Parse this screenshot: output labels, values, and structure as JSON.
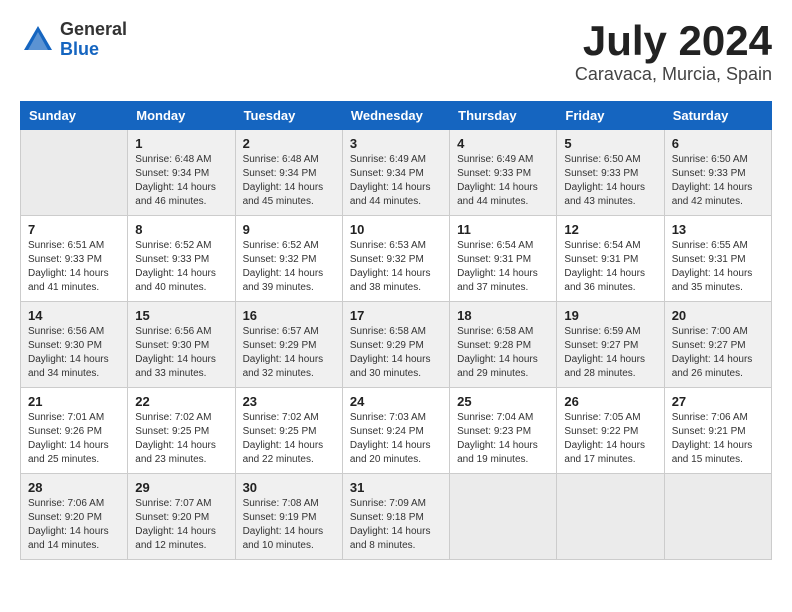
{
  "header": {
    "logo_general": "General",
    "logo_blue": "Blue",
    "month": "July 2024",
    "location": "Caravaca, Murcia, Spain"
  },
  "days_of_week": [
    "Sunday",
    "Monday",
    "Tuesday",
    "Wednesday",
    "Thursday",
    "Friday",
    "Saturday"
  ],
  "weeks": [
    [
      {
        "day": "",
        "info": ""
      },
      {
        "day": "1",
        "info": "Sunrise: 6:48 AM\nSunset: 9:34 PM\nDaylight: 14 hours\nand 46 minutes."
      },
      {
        "day": "2",
        "info": "Sunrise: 6:48 AM\nSunset: 9:34 PM\nDaylight: 14 hours\nand 45 minutes."
      },
      {
        "day": "3",
        "info": "Sunrise: 6:49 AM\nSunset: 9:34 PM\nDaylight: 14 hours\nand 44 minutes."
      },
      {
        "day": "4",
        "info": "Sunrise: 6:49 AM\nSunset: 9:33 PM\nDaylight: 14 hours\nand 44 minutes."
      },
      {
        "day": "5",
        "info": "Sunrise: 6:50 AM\nSunset: 9:33 PM\nDaylight: 14 hours\nand 43 minutes."
      },
      {
        "day": "6",
        "info": "Sunrise: 6:50 AM\nSunset: 9:33 PM\nDaylight: 14 hours\nand 42 minutes."
      }
    ],
    [
      {
        "day": "7",
        "info": "Sunrise: 6:51 AM\nSunset: 9:33 PM\nDaylight: 14 hours\nand 41 minutes."
      },
      {
        "day": "8",
        "info": "Sunrise: 6:52 AM\nSunset: 9:33 PM\nDaylight: 14 hours\nand 40 minutes."
      },
      {
        "day": "9",
        "info": "Sunrise: 6:52 AM\nSunset: 9:32 PM\nDaylight: 14 hours\nand 39 minutes."
      },
      {
        "day": "10",
        "info": "Sunrise: 6:53 AM\nSunset: 9:32 PM\nDaylight: 14 hours\nand 38 minutes."
      },
      {
        "day": "11",
        "info": "Sunrise: 6:54 AM\nSunset: 9:31 PM\nDaylight: 14 hours\nand 37 minutes."
      },
      {
        "day": "12",
        "info": "Sunrise: 6:54 AM\nSunset: 9:31 PM\nDaylight: 14 hours\nand 36 minutes."
      },
      {
        "day": "13",
        "info": "Sunrise: 6:55 AM\nSunset: 9:31 PM\nDaylight: 14 hours\nand 35 minutes."
      }
    ],
    [
      {
        "day": "14",
        "info": "Sunrise: 6:56 AM\nSunset: 9:30 PM\nDaylight: 14 hours\nand 34 minutes."
      },
      {
        "day": "15",
        "info": "Sunrise: 6:56 AM\nSunset: 9:30 PM\nDaylight: 14 hours\nand 33 minutes."
      },
      {
        "day": "16",
        "info": "Sunrise: 6:57 AM\nSunset: 9:29 PM\nDaylight: 14 hours\nand 32 minutes."
      },
      {
        "day": "17",
        "info": "Sunrise: 6:58 AM\nSunset: 9:29 PM\nDaylight: 14 hours\nand 30 minutes."
      },
      {
        "day": "18",
        "info": "Sunrise: 6:58 AM\nSunset: 9:28 PM\nDaylight: 14 hours\nand 29 minutes."
      },
      {
        "day": "19",
        "info": "Sunrise: 6:59 AM\nSunset: 9:27 PM\nDaylight: 14 hours\nand 28 minutes."
      },
      {
        "day": "20",
        "info": "Sunrise: 7:00 AM\nSunset: 9:27 PM\nDaylight: 14 hours\nand 26 minutes."
      }
    ],
    [
      {
        "day": "21",
        "info": "Sunrise: 7:01 AM\nSunset: 9:26 PM\nDaylight: 14 hours\nand 25 minutes."
      },
      {
        "day": "22",
        "info": "Sunrise: 7:02 AM\nSunset: 9:25 PM\nDaylight: 14 hours\nand 23 minutes."
      },
      {
        "day": "23",
        "info": "Sunrise: 7:02 AM\nSunset: 9:25 PM\nDaylight: 14 hours\nand 22 minutes."
      },
      {
        "day": "24",
        "info": "Sunrise: 7:03 AM\nSunset: 9:24 PM\nDaylight: 14 hours\nand 20 minutes."
      },
      {
        "day": "25",
        "info": "Sunrise: 7:04 AM\nSunset: 9:23 PM\nDaylight: 14 hours\nand 19 minutes."
      },
      {
        "day": "26",
        "info": "Sunrise: 7:05 AM\nSunset: 9:22 PM\nDaylight: 14 hours\nand 17 minutes."
      },
      {
        "day": "27",
        "info": "Sunrise: 7:06 AM\nSunset: 9:21 PM\nDaylight: 14 hours\nand 15 minutes."
      }
    ],
    [
      {
        "day": "28",
        "info": "Sunrise: 7:06 AM\nSunset: 9:20 PM\nDaylight: 14 hours\nand 14 minutes."
      },
      {
        "day": "29",
        "info": "Sunrise: 7:07 AM\nSunset: 9:20 PM\nDaylight: 14 hours\nand 12 minutes."
      },
      {
        "day": "30",
        "info": "Sunrise: 7:08 AM\nSunset: 9:19 PM\nDaylight: 14 hours\nand 10 minutes."
      },
      {
        "day": "31",
        "info": "Sunrise: 7:09 AM\nSunset: 9:18 PM\nDaylight: 14 hours\nand 8 minutes."
      },
      {
        "day": "",
        "info": ""
      },
      {
        "day": "",
        "info": ""
      },
      {
        "day": "",
        "info": ""
      }
    ]
  ]
}
